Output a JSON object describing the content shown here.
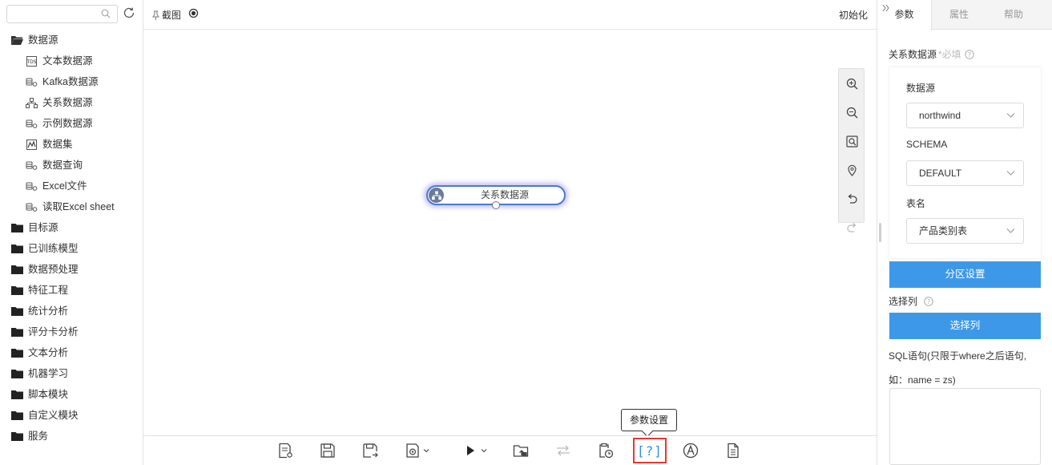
{
  "sidebar": {
    "search": {
      "placeholder": "",
      "value": ""
    },
    "tree": [
      {
        "label": "数据源",
        "children": [
          {
            "label": "文本数据源",
            "icon": "text-file-icon"
          },
          {
            "label": "Kafka数据源",
            "icon": "database-link-icon"
          },
          {
            "label": "关系数据源",
            "icon": "relation-icon"
          },
          {
            "label": "示例数据源",
            "icon": "database-link-icon"
          },
          {
            "label": "数据集",
            "icon": "dataset-icon"
          },
          {
            "label": "数据查询",
            "icon": "database-link-icon"
          },
          {
            "label": "Excel文件",
            "icon": "database-link-icon"
          },
          {
            "label": "读取Excel sheet",
            "icon": "database-link-icon"
          }
        ]
      },
      {
        "label": "目标源"
      },
      {
        "label": "已训练模型"
      },
      {
        "label": "数据预处理"
      },
      {
        "label": "特征工程"
      },
      {
        "label": "统计分析"
      },
      {
        "label": "评分卡分析"
      },
      {
        "label": "文本分析"
      },
      {
        "label": "机器学习"
      },
      {
        "label": "脚本模块"
      },
      {
        "label": "自定义模块"
      },
      {
        "label": "服务"
      }
    ]
  },
  "topbar": {
    "capture_label": "截图",
    "init_label": "初始化"
  },
  "canvas": {
    "node_label": "关系数据源"
  },
  "bottombar": {
    "help_label": "[?]",
    "tooltip": "参数设置"
  },
  "right_panel": {
    "tabs": [
      "参数",
      "属性",
      "帮助"
    ],
    "active_tab": "参数",
    "section_title": "关系数据源",
    "required_text": "*必填",
    "fields": [
      {
        "label": "数据源",
        "value": "northwind"
      },
      {
        "label": "SCHEMA",
        "value": "DEFAULT"
      },
      {
        "label": "表名",
        "value": "产品类别表"
      }
    ],
    "partition_button": "分区设置",
    "select_columns_label": "选择列",
    "select_columns_button": "选择列",
    "sql_label_line1": "SQL语句(只限于where之后语句,",
    "sql_label_line2": "如：name = zs)",
    "sql_value": ""
  },
  "colors": {
    "accent": "#3d99e8",
    "node_border": "#4a7bd0",
    "highlight": "#e53935",
    "help_blue": "#2f8fe8"
  }
}
